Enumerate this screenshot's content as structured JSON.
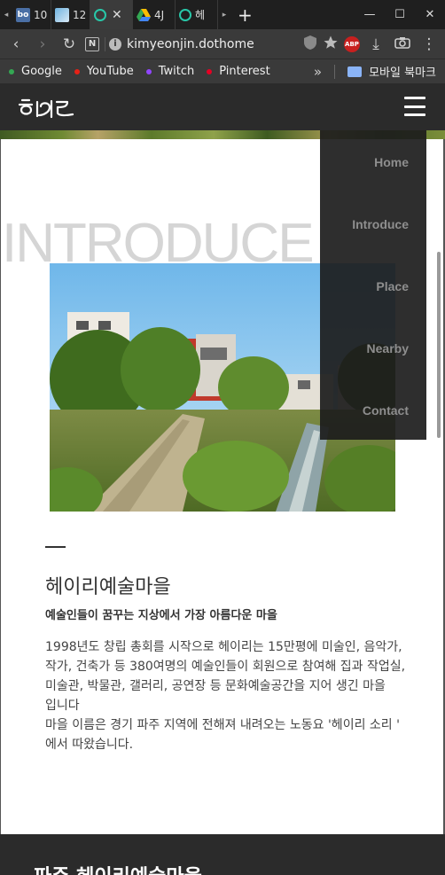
{
  "browser": {
    "tabs": [
      {
        "icon": "bo",
        "label": "bo",
        "title": "10",
        "active": false
      },
      {
        "icon": "image",
        "label": "",
        "title": "12",
        "active": false
      },
      {
        "icon": "ring",
        "label": "",
        "title": "",
        "active": true
      },
      {
        "icon": "google-drive",
        "label": "",
        "title": "4J",
        "active": false
      },
      {
        "icon": "ring",
        "label": "",
        "title": "헤",
        "active": false
      }
    ],
    "tab_close": "✕",
    "tab_scroll_left": "◂",
    "tab_scroll_right": "▸",
    "new_tab": "+",
    "window_controls": {
      "minimize": "—",
      "maximize": "☐",
      "close": "✕"
    },
    "toolbar": {
      "back": "‹",
      "forward": "›",
      "reload": "↻",
      "n_badge": "N",
      "address": "kimyeonjin.dothome",
      "info_glyph": "i",
      "abp_label": "ABP",
      "download": "⤓",
      "screenshot": "📷",
      "menu": "⋮"
    },
    "bookmarks": [
      {
        "label": "Google",
        "color": "#34a853"
      },
      {
        "label": "YouTube",
        "color": "#e62117"
      },
      {
        "label": "Twitch",
        "color": "#9146ff"
      },
      {
        "label": "Pinterest",
        "color": "#e60023"
      }
    ],
    "bookmarks_more": "»",
    "bookmark_folder": "모바일 북마크"
  },
  "site": {
    "logo_text": "헤이리",
    "section_heading": "INTRODUCE",
    "place_name": "헤이리예술마을",
    "place_subtitle": "예술인들이 꿈꾸는 지상에서 가장 아름다운 마을",
    "description": [
      "1998년도 창립 총회를 시작으로 헤이리는 15만평에 미술인, 음악가, 작가, 건축가 등 380여명의 예술인들이 회원으로 참여해 집과 작업실, 미술관, 박물관, 갤러리, 공연장 등 문화예술공간을 지어 생긴 마을 입니다",
      "마을 이름은 경기 파주 지역에 전해져 내려오는 노동요 '헤이리 소리 ' 에서 따왔습니다."
    ],
    "footer_title": "파주 헤이리예술마을",
    "menu": [
      "Home",
      "Introduce",
      "Place",
      "Nearby",
      "Contact"
    ]
  },
  "colors": {
    "header_bg": "#2b2b2b",
    "menu_text": "#8e8e8e",
    "heading_ghost": "#d5d5d5"
  }
}
